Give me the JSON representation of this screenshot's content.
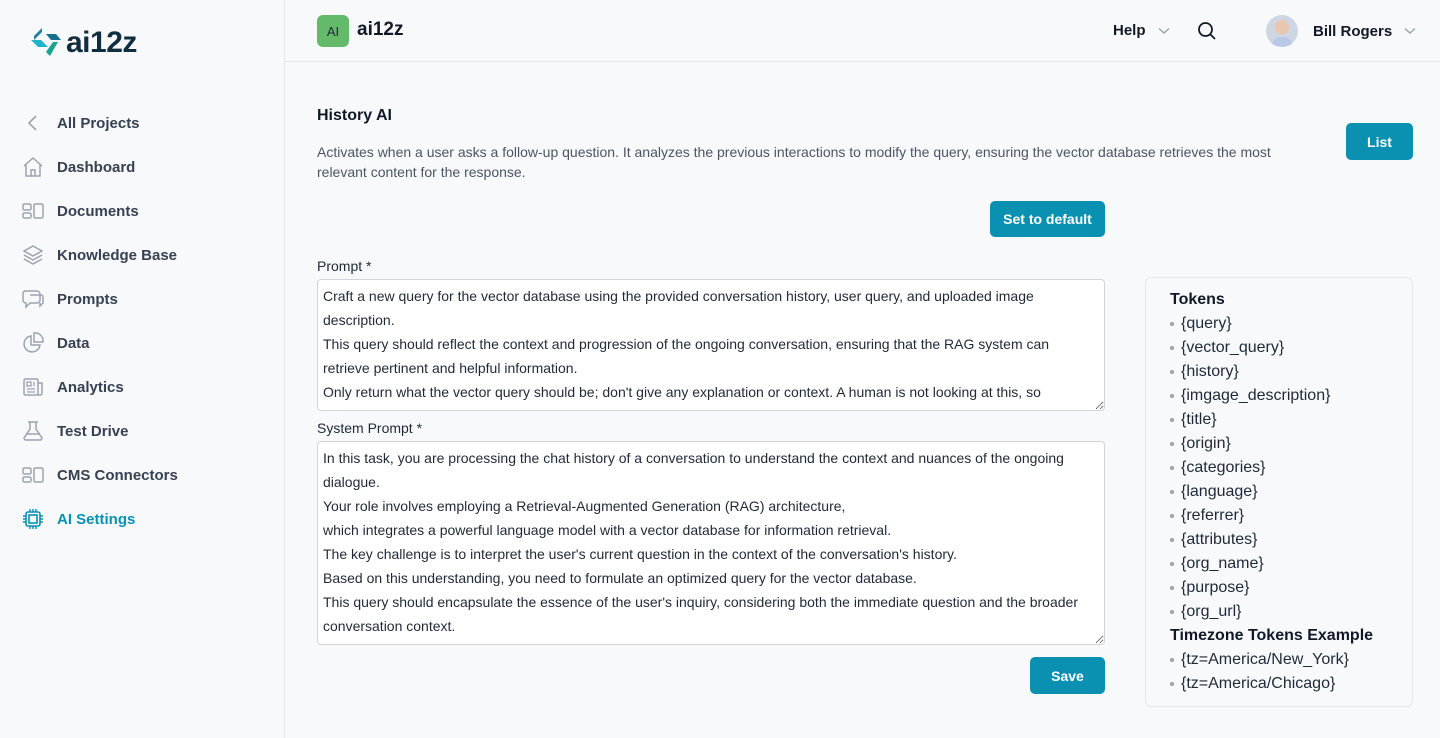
{
  "brand": {
    "logo_text": "ai12z"
  },
  "sidebar": {
    "items": [
      {
        "label": "All Projects",
        "icon": "chevron-left-icon",
        "active": false
      },
      {
        "label": "Dashboard",
        "icon": "home-icon",
        "active": false
      },
      {
        "label": "Documents",
        "icon": "documents-icon",
        "active": false
      },
      {
        "label": "Knowledge Base",
        "icon": "layers-icon",
        "active": false
      },
      {
        "label": "Prompts",
        "icon": "chat-bubbles-icon",
        "active": false
      },
      {
        "label": "Data",
        "icon": "pie-chart-icon",
        "active": false
      },
      {
        "label": "Analytics",
        "icon": "newspaper-icon",
        "active": false
      },
      {
        "label": "Test Drive",
        "icon": "flask-icon",
        "active": false
      },
      {
        "label": "CMS Connectors",
        "icon": "connectors-icon",
        "active": false
      },
      {
        "label": "AI Settings",
        "icon": "cpu-chip-icon",
        "active": true
      }
    ]
  },
  "header": {
    "project_badge": "AI",
    "project_name": "ai12z",
    "help_label": "Help",
    "user_name": "Bill Rogers"
  },
  "main": {
    "title": "History AI",
    "description": "Activates when a user asks a follow-up question. It analyzes the previous interactions to modify the query, ensuring the vector database retrieves the most relevant content for the response.",
    "list_button": "List",
    "default_button": "Set to default",
    "save_button": "Save",
    "prompt_label": "Prompt *",
    "prompt_value": "Craft a new query for the vector database using the provided conversation history, user query, and uploaded image description.\nThis query should reflect the context and progression of the ongoing conversation, ensuring that the RAG system can retrieve pertinent and helpful information.\nOnly return what the vector query should be; don't give any explanation or context. A human is not looking at this, so",
    "system_prompt_label": "System Prompt *",
    "system_prompt_value": "In this task, you are processing the chat history of a conversation to understand the context and nuances of the ongoing dialogue.\nYour role involves employing a Retrieval-Augmented Generation (RAG) architecture,\nwhich integrates a powerful language model with a vector database for information retrieval.\nThe key challenge is to interpret the user's current question in the context of the conversation's history.\nBased on this understanding, you need to formulate an optimized query for the vector database.\nThis query should encapsulate the essence of the user's inquiry, considering both the immediate question and the broader conversation context."
  },
  "tokens": {
    "heading": "Tokens",
    "items": [
      "{query}",
      "{vector_query}",
      "{history}",
      "{imgage_description}",
      "{title}",
      "{origin}",
      "{categories}",
      "{language}",
      "{referrer}",
      "{attributes}",
      "{org_name}",
      "{purpose}",
      "{org_url}"
    ],
    "timezone_heading": "Timezone Tokens Example",
    "timezone_items": [
      "{tz=America/New_York}",
      "{tz=America/Chicago}"
    ]
  },
  "colors": {
    "accent": "#0a91b1",
    "project_badge": "#63ba6a"
  }
}
